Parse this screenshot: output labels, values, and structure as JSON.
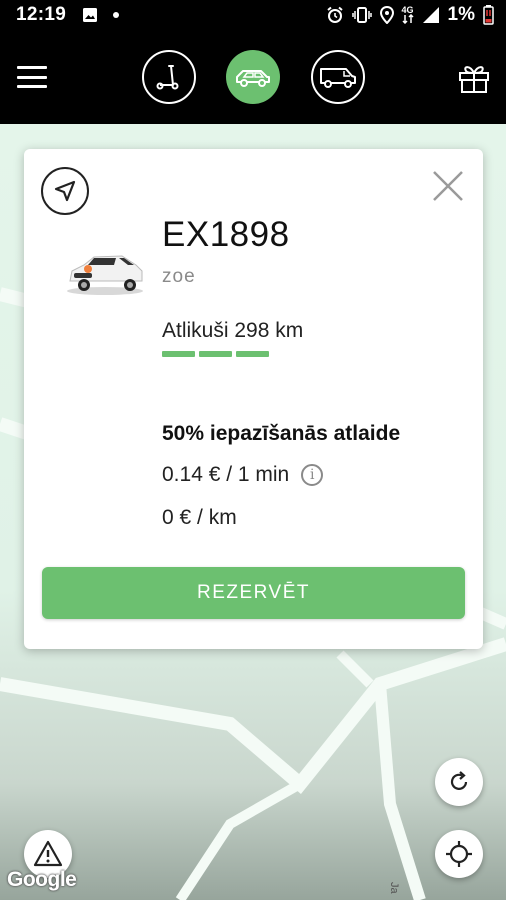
{
  "status_bar": {
    "time": "12:19",
    "battery_text": "1%",
    "network_label": "4G",
    "icons": [
      "image-notification-icon",
      "dot-icon",
      "alarm-icon",
      "vibrate-icon",
      "location-icon",
      "network-4g-icon",
      "signal-icon",
      "battery-low-icon"
    ]
  },
  "top_bar": {
    "modes": [
      {
        "name": "scooter",
        "icon": "scooter-icon",
        "active": false
      },
      {
        "name": "car",
        "icon": "car-icon",
        "active": true
      },
      {
        "name": "van",
        "icon": "van-icon",
        "active": false
      }
    ],
    "menu_icon": "hamburger-menu-icon",
    "gift_icon": "gift-icon"
  },
  "vehicle_card": {
    "plate": "EX1898",
    "model": "zoe",
    "range_text": "Atlikuši 298 km",
    "range_segments": 3,
    "promo_text": "50% iepazīšanās atlaide",
    "price_per_min": "0.14 € / 1 min",
    "price_per_km": "0 € / km",
    "reserve_label": "REZERVĒT"
  },
  "map": {
    "attribution": "Google",
    "street_fragment": "Ja"
  },
  "colors": {
    "accent": "#6cc070",
    "top_bar_bg": "#000000",
    "map_bg": "#e0f2e7"
  }
}
